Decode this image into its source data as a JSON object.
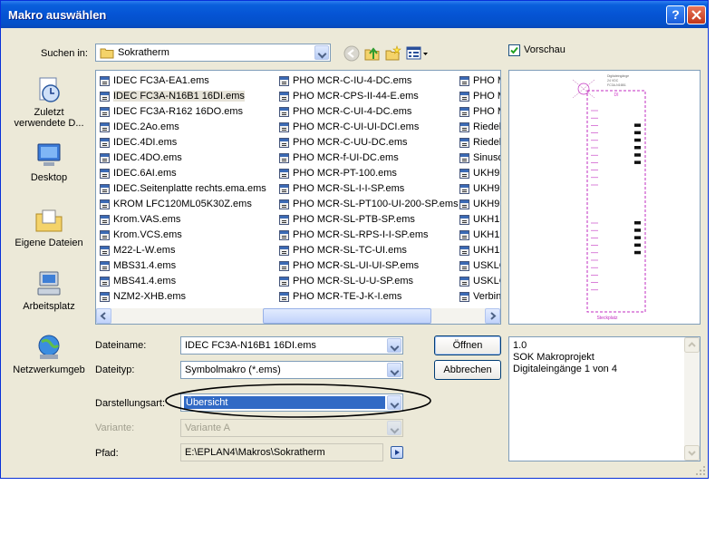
{
  "dialog": {
    "title": "Makro auswählen",
    "help_icon": "help-icon",
    "close_icon": "close-icon"
  },
  "lookin": {
    "label": "Suchen in:",
    "value": "Sokratherm",
    "icon": "folder-icon"
  },
  "toolbar": {
    "back_icon": "back-arrow-icon",
    "up_icon": "folder-up-icon",
    "new_folder_icon": "new-folder-icon",
    "view_icon": "view-menu-icon"
  },
  "preview_checkbox": {
    "label": "Vorschau",
    "checked": true
  },
  "places": [
    {
      "label": "Zuletzt verwendete D...",
      "icon": "recent-documents-icon"
    },
    {
      "label": "Desktop",
      "icon": "desktop-icon"
    },
    {
      "label": "Eigene Dateien",
      "icon": "my-documents-icon"
    },
    {
      "label": "Arbeitsplatz",
      "icon": "my-computer-icon"
    },
    {
      "label": "Netzwerkumgeb",
      "icon": "network-icon"
    }
  ],
  "files": {
    "col1": [
      "IDEC FC3A-EA1.ems",
      "IDEC FC3A-N16B1 16DI.ems",
      "IDEC FC3A-R162 16DO.ems",
      "IDEC.2Ao.ems",
      "IDEC.4DI.ems",
      "IDEC.4DO.ems",
      "IDEC.6AI.ems",
      "IDEC.Seitenplatte rechts.ema.ems",
      "KROM LFC120ML05K30Z.ems",
      "Krom.VAS.ems",
      "Krom.VCS.ems",
      "M22-L-W.ems",
      "MBS31.4.ems",
      "MBS41.4.ems",
      "NZM2-XHB.ems"
    ],
    "col2": [
      "PHO MCR-C-IU-4-DC.ems",
      "PHO MCR-CPS-II-44-E.ems",
      "PHO MCR-C-UI-4-DC.ems",
      "PHO MCR-C-UI-UI-DCI.ems",
      "PHO MCR-C-UU-DC.ems",
      "PHO MCR-f-UI-DC.ems",
      "PHO MCR-PT-100.ems",
      "PHO MCR-SL-I-I-SP.ems",
      "PHO MCR-SL-PT100-UI-200-SP.ems",
      "PHO MCR-SL-PTB-SP.ems",
      "PHO MCR-SL-RPS-I-I-SP.ems",
      "PHO MCR-SL-TC-UI.ems",
      "PHO MCR-SL-UI-UI-SP.ems",
      "PHO MCR-SL-U-U-SP.ems",
      "PHO MCR-TE-J-K-I.ems"
    ],
    "col3": [
      "PHO M",
      "PHO M",
      "PHO M",
      "Riedel",
      "Riedel",
      "Sinusd",
      "UKH95",
      "UKH95",
      "UKH95",
      "UKH15",
      "UKH15",
      "UKH15",
      "USKLG",
      "USKLG",
      "Verbin"
    ],
    "selected_index": 1,
    "file_icon": "macro-file-icon"
  },
  "preview": {
    "header_lines": [
      "Digitaleingänge",
      "24 VDC",
      "FC3A-N16B1"
    ],
    "module_label": "DI",
    "footer": "Steckplatz"
  },
  "form": {
    "filename_label": "Dateiname:",
    "filename_value": "IDEC FC3A-N16B1 16DI.ems",
    "filetype_label": "Dateityp:",
    "filetype_value": "Symbolmakro (*.ems)",
    "view_label": "Darstellungsart:",
    "view_value": "Übersicht",
    "variant_label": "Variante:",
    "variant_value": "Variante A",
    "path_label": "Pfad:",
    "path_value": "E:\\EPLAN4\\Makros\\Sokratherm"
  },
  "buttons": {
    "open": "Öffnen",
    "cancel": "Abbrechen"
  },
  "info": {
    "lines": [
      "1.0",
      "SOK Makroprojekt",
      "Digitaleingänge 1 von 4"
    ]
  }
}
